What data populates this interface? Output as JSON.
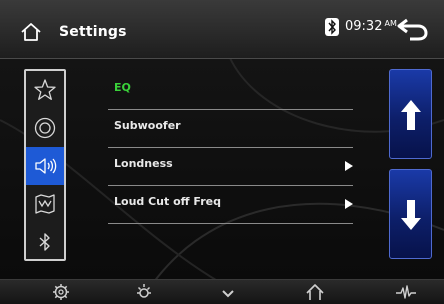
{
  "header": {
    "title": "Settings",
    "time": "09:32",
    "ampm": "AM",
    "icons": [
      "home-icon",
      "bluetooth-icon",
      "back-icon"
    ]
  },
  "sidebar": {
    "items": [
      {
        "icon": "star-icon",
        "active": false
      },
      {
        "icon": "disc-icon",
        "active": false
      },
      {
        "icon": "speaker-icon",
        "active": true
      },
      {
        "icon": "map-icon",
        "active": false
      },
      {
        "icon": "bluetooth-icon",
        "active": false
      }
    ],
    "active_color": "#1e5ad6"
  },
  "menu": {
    "items": [
      {
        "label": "EQ",
        "has_arrow": false,
        "color": "#3ad13a"
      },
      {
        "label": "Subwoofer",
        "has_arrow": false,
        "color": "#e8e8e8"
      },
      {
        "label": "Londness",
        "has_arrow": true,
        "color": "#e8e8e8"
      },
      {
        "label": "Loud Cut off Freq",
        "has_arrow": true,
        "color": "#e8e8e8"
      }
    ]
  },
  "scroll": {
    "up_icon": "arrow-up-icon",
    "down_icon": "arrow-down-icon",
    "color": "#1a3aa8"
  },
  "bottombar": {
    "icons": [
      "gear-icon",
      "brightness-icon",
      "chevron-down-icon",
      "home-icon",
      "waveform-icon"
    ]
  }
}
